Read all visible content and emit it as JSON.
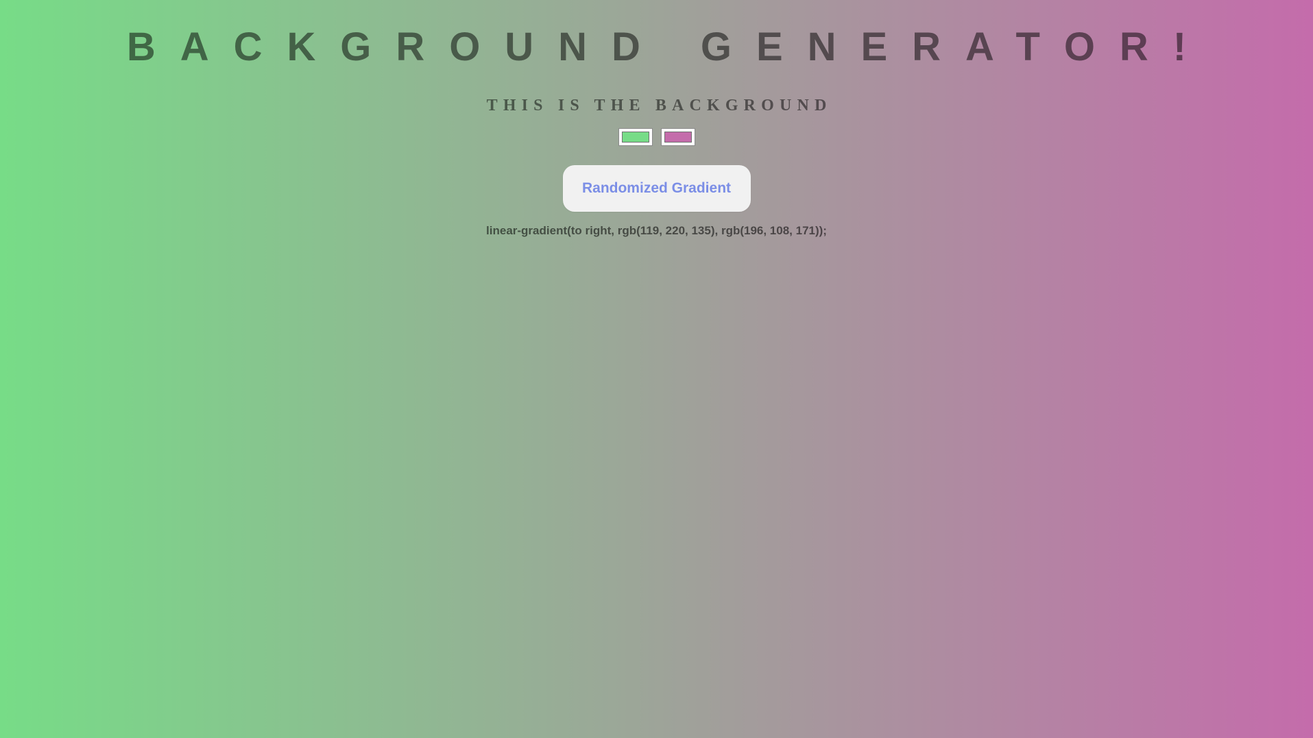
{
  "page": {
    "title": "BACKGROUND GENERATOR!",
    "subtitle": "THIS IS THE BACKGROUND"
  },
  "colors": {
    "color1": "#77dc87",
    "color2": "#c46cab"
  },
  "controls": {
    "randomize_label": "Randomized Gradient"
  },
  "output": {
    "css_text": "linear-gradient(to right, rgb(119, 220, 135), rgb(196, 108, 171));"
  }
}
